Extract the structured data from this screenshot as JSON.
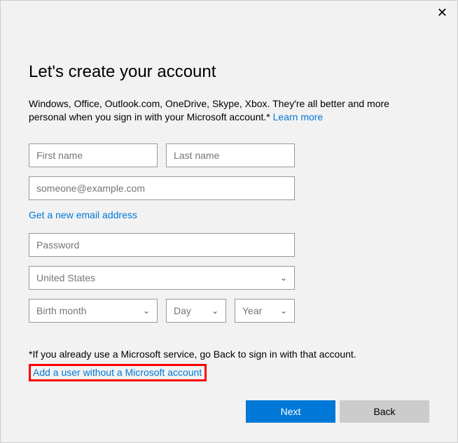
{
  "close_tooltip": "Close",
  "title": "Let's create your account",
  "description_prefix": "Windows, Office, Outlook.com, OneDrive, Skype, Xbox. They're all better and more personal when you sign in with your Microsoft account.* ",
  "learn_more_label": "Learn more",
  "fields": {
    "first_name_placeholder": "First name",
    "last_name_placeholder": "Last name",
    "email_placeholder": "someone@example.com",
    "password_placeholder": "Password"
  },
  "get_new_email_label": "Get a new email address",
  "country_selected": "United States",
  "birth": {
    "month_placeholder": "Birth month",
    "day_placeholder": "Day",
    "year_placeholder": "Year"
  },
  "footnote": "*If you already use a Microsoft service, go Back to sign in with that account.",
  "add_user_without_account_label": "Add a user without a Microsoft account",
  "buttons": {
    "next": "Next",
    "back": "Back"
  }
}
